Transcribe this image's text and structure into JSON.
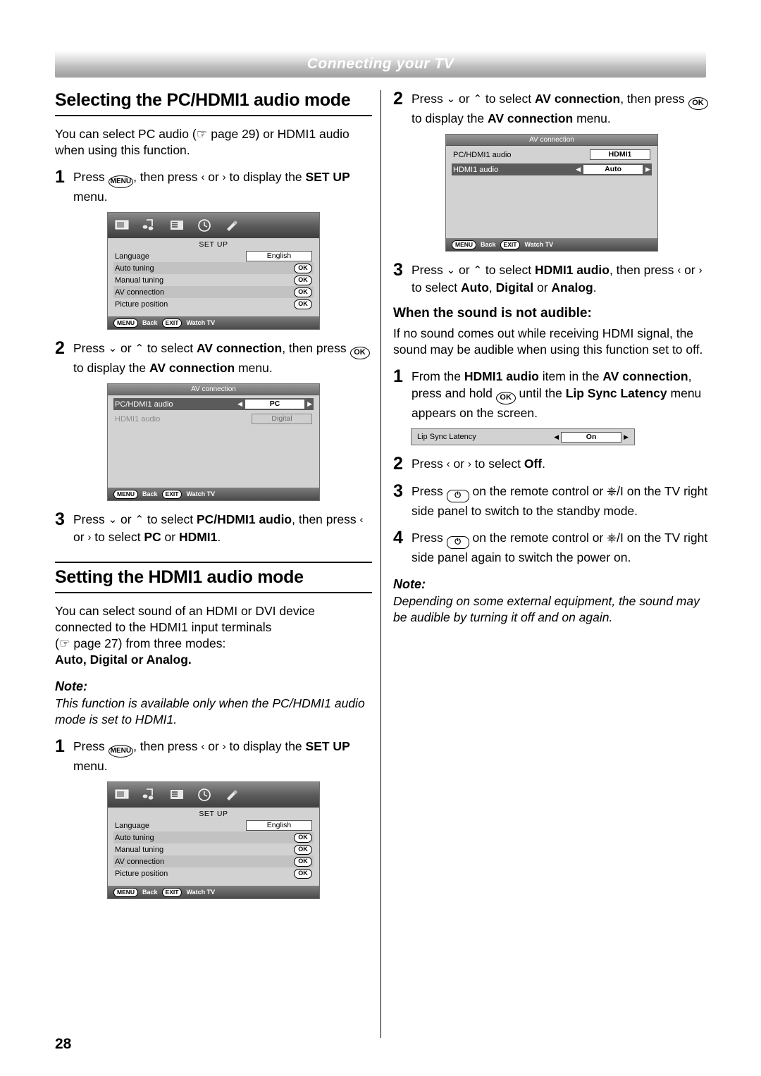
{
  "header": {
    "title": "Connecting your TV"
  },
  "page_number": "28",
  "left": {
    "section1_title": "Selecting the PC/HDMI1 audio mode",
    "intro": "You can select PC audio (☞ page 29) or HDMI1 audio when using this function.",
    "step1": {
      "num": "1",
      "text_before": "Press ",
      "key": "MENU",
      "text_mid": ", then press ",
      "text_after": " to display the ",
      "bold_tail": "SET UP",
      "text_end": " menu."
    },
    "step2": {
      "num": "2",
      "text_a": "Press ",
      "text_b": " to select ",
      "bold_b": "AV connection",
      "text_c": ", then press ",
      "key": "OK",
      "text_d": " to display the ",
      "bold_d": "AV connection",
      "text_e": " menu."
    },
    "step3": {
      "num": "3",
      "text_a": "Press ",
      "text_b": " to select ",
      "bold_b": "PC/HDMI1 audio",
      "text_c": ", then press ",
      "text_d": " to select ",
      "bold_d1": "PC",
      "text_e": " or ",
      "bold_d2": "HDMI1",
      "text_f": "."
    },
    "section2_title": "Setting the HDMI1 audio mode",
    "intro2_line1": "You can select sound of an HDMI or DVI device connected to the HDMI1 input terminals",
    "intro2_line2": "(☞ page 27) from three modes:",
    "intro2_bold": "Auto, Digital or Analog.",
    "note_label": "Note:",
    "note_text": "This function is available only when the PC/HDMI1 audio mode is set to HDMI1.",
    "step4": {
      "num": "1",
      "text_before": "Press ",
      "key": "MENU",
      "text_mid": ", then press ",
      "text_after": " to display the ",
      "bold_tail": "SET UP",
      "text_end": " menu."
    },
    "osd_setup": {
      "title": "SET UP",
      "rows": [
        {
          "label": "Language",
          "value": "English",
          "type": "value"
        },
        {
          "label": "Auto tuning",
          "value": "OK",
          "type": "ok"
        },
        {
          "label": "Manual tuning",
          "value": "OK",
          "type": "ok"
        },
        {
          "label": "AV connection",
          "value": "OK",
          "type": "ok"
        },
        {
          "label": "Picture position",
          "value": "OK",
          "type": "ok"
        }
      ],
      "foot": {
        "btn1": "MENU",
        "lbl1": "Back",
        "btn2": "EXIT",
        "lbl2": "Watch TV"
      }
    },
    "osd_av": {
      "title": "AV connection",
      "rows": [
        {
          "label": "PC/HDMI1 audio",
          "value": "PC",
          "selected": true
        },
        {
          "label": "HDMI1 audio",
          "value": "Digital",
          "selected": false
        }
      ],
      "foot": {
        "btn1": "MENU",
        "lbl1": "Back",
        "btn2": "EXIT",
        "lbl2": "Watch TV"
      }
    }
  },
  "right": {
    "step2": {
      "num": "2",
      "text_a": "Press ",
      "text_b": " to select ",
      "bold_b": "AV connection",
      "text_c": ", then press ",
      "key": "OK",
      "text_d": " to display the ",
      "bold_d": "AV connection",
      "text_e": " menu."
    },
    "osd_av": {
      "title": "AV connection",
      "rows": [
        {
          "label": "PC/HDMI1 audio",
          "value": "HDMI1",
          "selected": false
        },
        {
          "label": "HDMI1 audio",
          "value": "Auto",
          "selected": true
        }
      ],
      "foot": {
        "btn1": "MENU",
        "lbl1": "Back",
        "btn2": "EXIT",
        "lbl2": "Watch TV"
      }
    },
    "step3": {
      "num": "3",
      "text_a": "Press ",
      "text_b": " to select ",
      "bold_b": "HDMI1 audio",
      "text_c": ", then press ",
      "text_d": " to select ",
      "bold_d1": "Auto",
      "sep1": ", ",
      "bold_d2": "Digital",
      "sep2": " or ",
      "bold_d3": "Analog",
      "text_f": "."
    },
    "subhead": "When the sound is not audible:",
    "para": "If no sound comes out while receiving HDMI signal, the sound may be audible when using this function set to off.",
    "step_a": {
      "num": "1",
      "t1": "From the ",
      "b1": "HDMI1 audio",
      "t2": " item in the ",
      "b2": "AV connection",
      "t3": ", press and hold ",
      "key": "OK",
      "t4": " until the ",
      "b3": "Lip Sync Latency",
      "t5": " menu appears on the screen."
    },
    "osd_lip": {
      "label": "Lip Sync Latency",
      "value": "On"
    },
    "step_b": {
      "num": "2",
      "t1": "Press ",
      "t2": " to select ",
      "b1": "Off",
      "t3": "."
    },
    "step_c": {
      "num": "3",
      "t1": "Press ",
      "t2": " on the remote control or ",
      "t3": " on the TV right side panel to switch to the standby mode."
    },
    "step_d": {
      "num": "4",
      "t1": "Press ",
      "t2": " on the remote control or ",
      "t3": " on the TV right side panel again to switch the power on."
    },
    "note_label": "Note:",
    "note_text": "Depending on some external equipment, the sound may be audible by turning it off and on again."
  }
}
